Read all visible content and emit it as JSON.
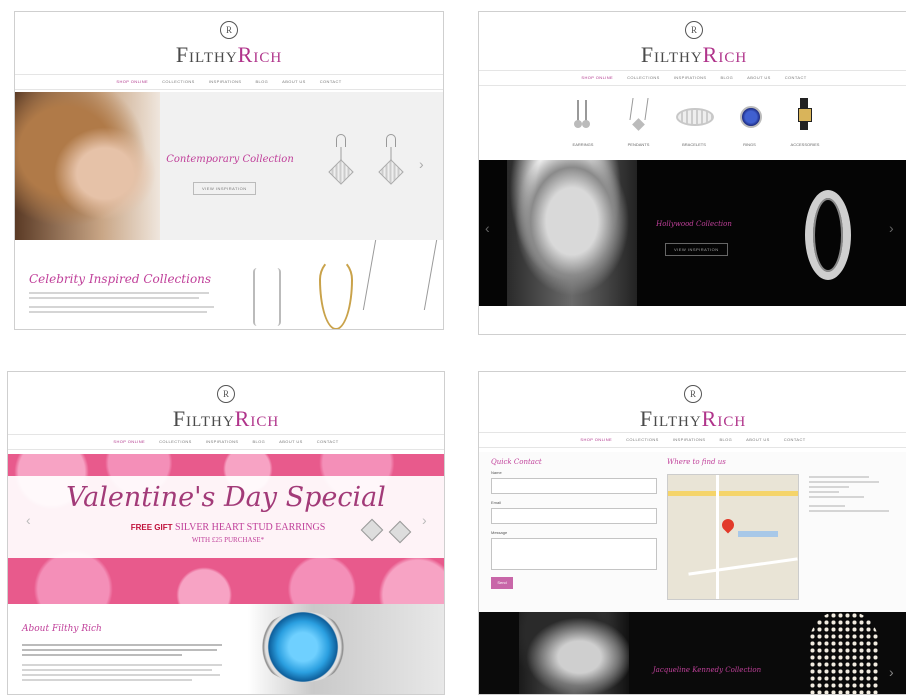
{
  "brand": {
    "word1": "Filthy",
    "word2": "Rich",
    "monogram": "R"
  },
  "nav": [
    "SHOP ONLINE",
    "COLLECTIONS",
    "INSPIRATIONS",
    "BLOG",
    "ABOUT US",
    "CONTACT"
  ],
  "panel1": {
    "hero_title": "Contemporary Collection",
    "hero_button": "VIEW INSPIRATION",
    "section_title": "Celebrity Inspired Collections"
  },
  "panel2": {
    "categories": [
      "EARRINGS",
      "PENDANTS",
      "BRACELETS",
      "RINGS",
      "ACCESSORIES"
    ],
    "hero_title": "Hollywood Collection",
    "hero_button": "VIEW INSPIRATION"
  },
  "panel3": {
    "banner_title": "Valentine's Day Special",
    "banner_line1_red": "FREE GIFT",
    "banner_line1_pink": "SILVER HEART STUD EARRINGS",
    "banner_line2": "WITH £25 PURCHASE*",
    "section_title": "About Filthy Rich"
  },
  "panel4": {
    "form_title": "Quick Contact",
    "label_name": "Name",
    "label_email": "Email",
    "label_message": "Message",
    "send_button": "Send",
    "map_title": "Where to find us",
    "hero_title": "Jacqueline Kennedy Collection"
  },
  "colors": {
    "brand_pink": "#b0348b",
    "script_pink": "#c0409a",
    "roses": "#e85a8c"
  }
}
